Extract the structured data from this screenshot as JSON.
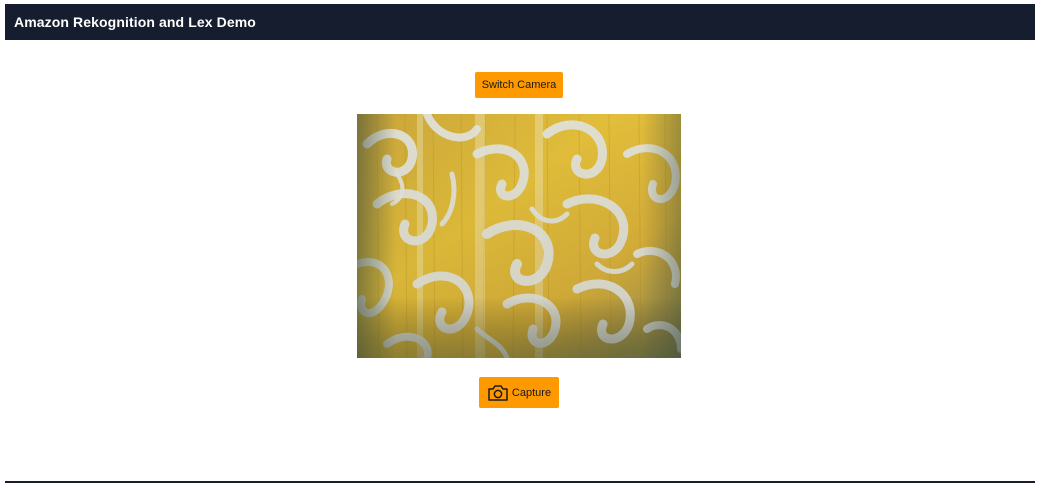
{
  "header": {
    "title": "Amazon Rekognition and Lex Demo",
    "background_color": "#161d2e"
  },
  "controls": {
    "switch_camera_label": "Switch Camera",
    "capture_label": "Capture",
    "capture_icon": "camera-icon",
    "accent_color": "#ff9900"
  },
  "camera_feed": {
    "description_icon": "video-feed"
  }
}
